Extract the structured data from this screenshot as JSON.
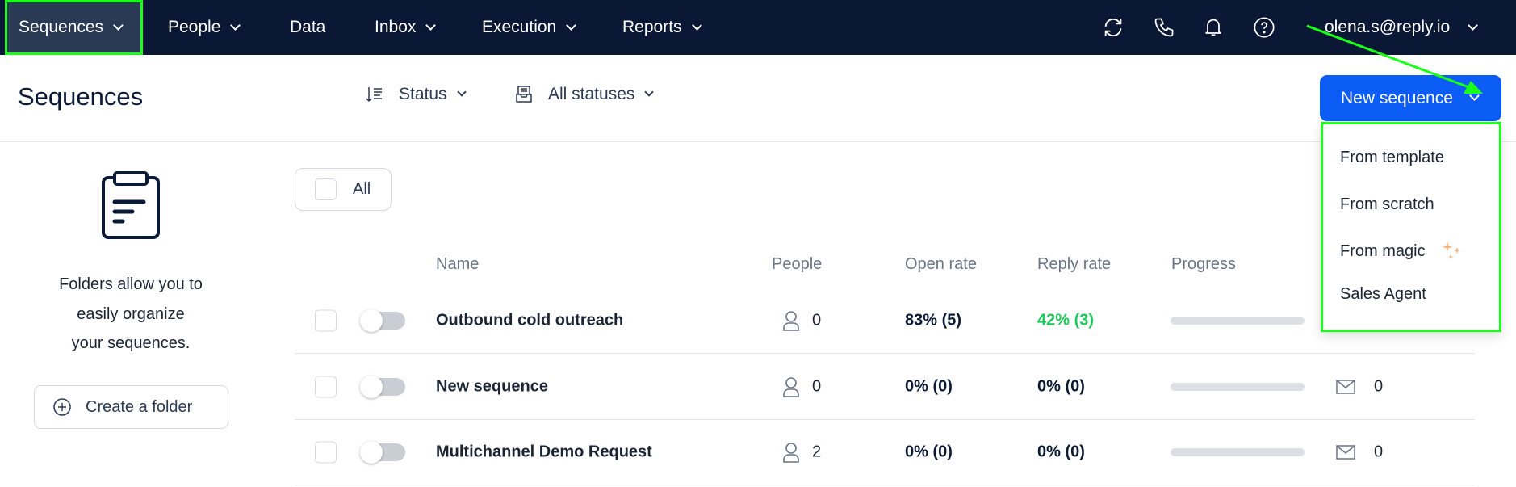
{
  "nav": {
    "items": [
      {
        "label": "Sequences",
        "has_dropdown": true,
        "active": true
      },
      {
        "label": "People",
        "has_dropdown": true
      },
      {
        "label": "Data",
        "has_dropdown": false
      },
      {
        "label": "Inbox",
        "has_dropdown": true
      },
      {
        "label": "Execution",
        "has_dropdown": true
      },
      {
        "label": "Reports",
        "has_dropdown": true
      }
    ],
    "icons": [
      "sync-icon",
      "phone-icon",
      "bell-icon",
      "help-icon"
    ],
    "user_email": "olena.s@reply.io"
  },
  "header": {
    "title": "Sequences",
    "sort_label": "Status",
    "status_filter": "All statuses",
    "new_button": "New sequence"
  },
  "new_menu": {
    "items": [
      {
        "label": "From template"
      },
      {
        "label": "From scratch"
      },
      {
        "label": "From magic",
        "icon": "sparkles-icon"
      },
      {
        "label": "Sales Agent"
      }
    ]
  },
  "folders": {
    "line1": "Folders allow you to",
    "line2": "easily organize",
    "line3": "your sequences.",
    "create_label": "Create a folder"
  },
  "table": {
    "select_all": "All",
    "columns": [
      "Name",
      "People",
      "Open rate",
      "Reply rate",
      "Progress"
    ],
    "rows": [
      {
        "name": "Outbound cold outreach",
        "people": "0",
        "open_rate": "83% (5)",
        "reply_rate": "42% (3)",
        "reply_highlight": true,
        "progress": 0,
        "emails": ""
      },
      {
        "name": "New sequence",
        "people": "0",
        "open_rate": "0% (0)",
        "reply_rate": "0% (0)",
        "progress": 0,
        "emails": "0"
      },
      {
        "name": "Multichannel Demo Request",
        "people": "2",
        "open_rate": "0% (0)",
        "reply_rate": "0% (0)",
        "progress": 0,
        "emails": "0"
      }
    ]
  },
  "colors": {
    "nav_bg": "#0a1836",
    "primary": "#0c5cf6",
    "positive": "#1ec85a",
    "highlight": "#1aff1a"
  }
}
